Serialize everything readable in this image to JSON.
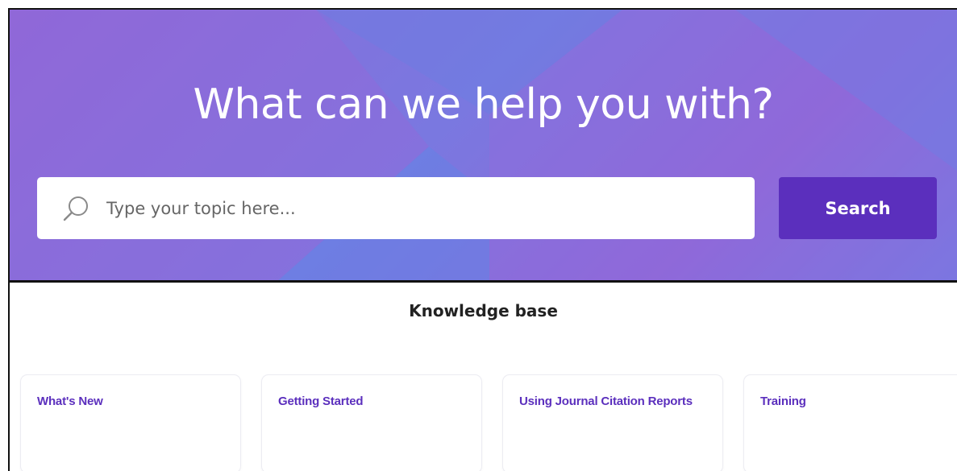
{
  "hero": {
    "title": "What can we help you with?",
    "search": {
      "placeholder": "Type your topic here...",
      "value": "",
      "button_label": "Search",
      "icon": "search-icon"
    }
  },
  "knowledge_base": {
    "heading": "Knowledge base",
    "cards": [
      {
        "title": "What's New"
      },
      {
        "title": "Getting Started"
      },
      {
        "title": "Using Journal Citation Reports"
      },
      {
        "title": "Training"
      }
    ]
  },
  "colors": {
    "accent": "#5b2fbd",
    "hero_gradient_start": "#8a6ad9",
    "hero_gradient_end": "#6e7de3",
    "card_title": "#5b2fbd"
  }
}
